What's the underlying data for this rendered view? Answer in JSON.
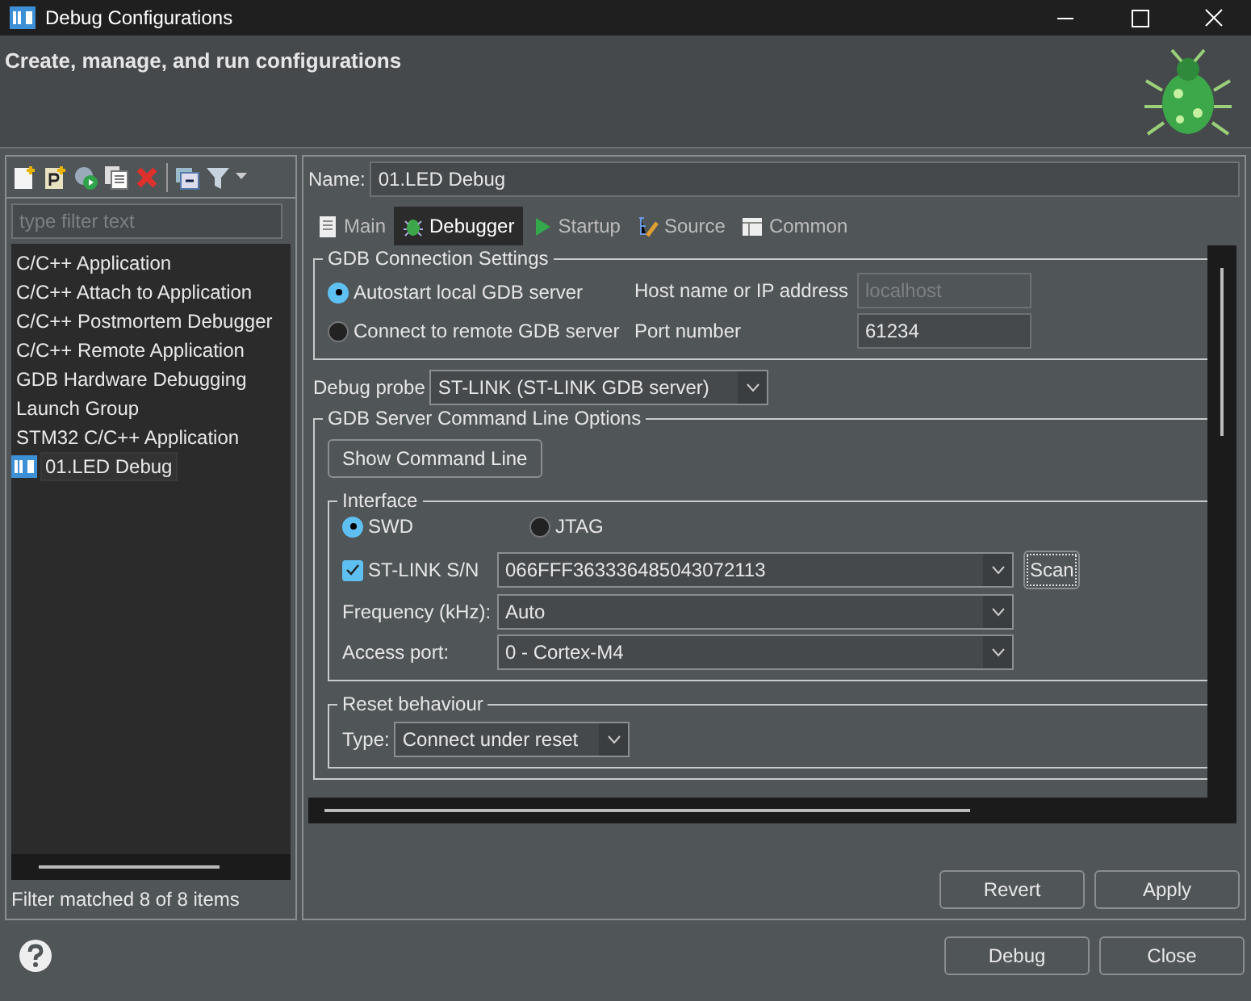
{
  "window": {
    "title": "Debug Configurations"
  },
  "header": {
    "title": "Create, manage, and run configurations"
  },
  "filter": {
    "placeholder": "type filter text"
  },
  "tree": {
    "items": [
      {
        "label": "C/C++ Application",
        "kind": "type",
        "selected": false
      },
      {
        "label": "C/C++ Attach to Application",
        "kind": "type",
        "selected": false
      },
      {
        "label": "C/C++ Postmortem Debugger",
        "kind": "type",
        "selected": false
      },
      {
        "label": "C/C++ Remote Application",
        "kind": "type",
        "selected": false
      },
      {
        "label": "GDB Hardware Debugging",
        "kind": "type",
        "selected": false
      },
      {
        "label": "Launch Group",
        "kind": "type",
        "selected": false
      },
      {
        "label": "STM32 C/C++ Application",
        "kind": "type",
        "selected": false
      },
      {
        "label": "01.LED Debug",
        "kind": "config",
        "selected": true
      }
    ]
  },
  "filter_status": "Filter matched 8 of 8 items",
  "name": {
    "label": "Name:",
    "value": "01.LED Debug"
  },
  "tabs": [
    {
      "label": "Main",
      "kind": "main",
      "selected": false
    },
    {
      "label": "Debugger",
      "kind": "debugger",
      "selected": true
    },
    {
      "label": "Startup",
      "kind": "startup",
      "selected": false
    },
    {
      "label": "Source",
      "kind": "source",
      "selected": false
    },
    {
      "label": "Common",
      "kind": "common",
      "selected": false
    }
  ],
  "gdb_connection": {
    "title": "GDB Connection Settings",
    "options": [
      {
        "label": "Autostart local GDB server",
        "selected": true
      },
      {
        "label": "Connect to remote GDB server",
        "selected": false
      }
    ],
    "host": {
      "label": "Host name or IP address",
      "value": "localhost",
      "disabled": true
    },
    "port": {
      "label": "Port number",
      "value": "61234",
      "disabled": false
    }
  },
  "debug_probe": {
    "label": "Debug probe",
    "value": "ST-LINK (ST-LINK GDB server)"
  },
  "server_options": {
    "title": "GDB Server Command Line Options",
    "show_button": "Show Command Line",
    "interface": {
      "title": "Interface",
      "options": [
        {
          "label": "SWD",
          "selected": true
        },
        {
          "label": "JTAG",
          "selected": false
        }
      ],
      "serial": {
        "label": "ST-LINK S/N",
        "checked": true,
        "value": "066FFF363336485043072113"
      },
      "scan": "Scan",
      "frequency": {
        "label": "Frequency (kHz):",
        "value": "Auto"
      },
      "access_port": {
        "label": "Access port:",
        "value": "0 - Cortex-M4"
      }
    },
    "reset": {
      "title": "Reset behaviour",
      "type": {
        "label": "Type:",
        "value": "Connect under reset"
      }
    }
  },
  "buttons": {
    "revert": "Revert",
    "apply": "Apply",
    "debug": "Debug",
    "close": "Close"
  }
}
